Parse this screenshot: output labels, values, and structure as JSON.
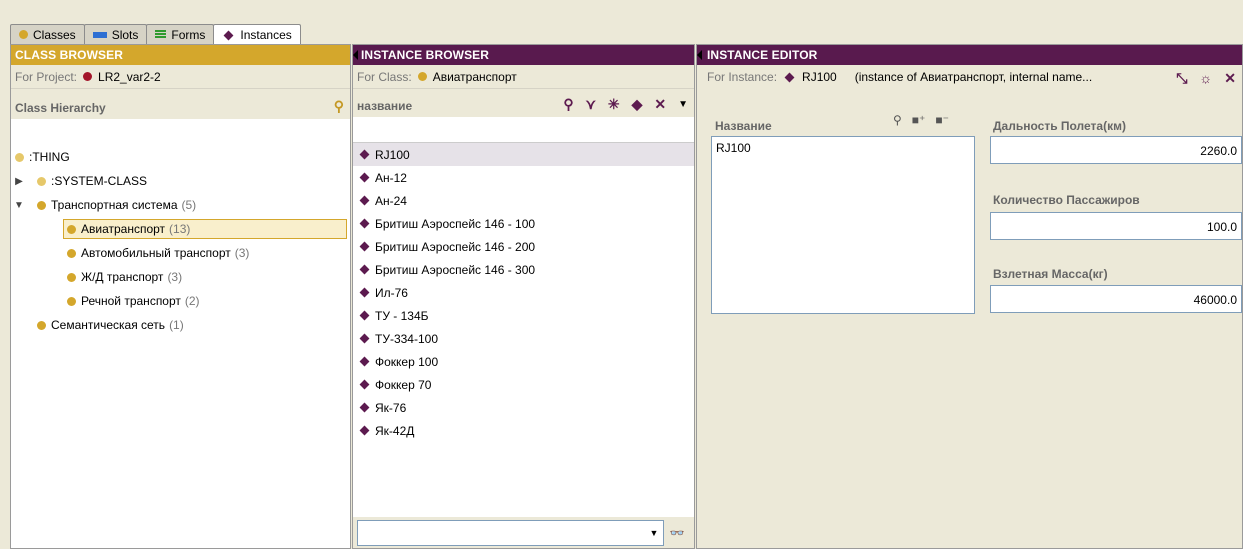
{
  "tabs": [
    {
      "label": "Classes",
      "icon": "class-dot-icon"
    },
    {
      "label": "Slots",
      "icon": "slot-icon"
    },
    {
      "label": "Forms",
      "icon": "form-icon"
    },
    {
      "label": "Instances",
      "icon": "instance-diamond-icon"
    }
  ],
  "class_browser": {
    "title": "CLASS BROWSER",
    "project_label": "For Project:",
    "project_name": "LR2_var2-2",
    "hierarchy_label": "Class Hierarchy",
    "tree": [
      {
        "label": ":THING",
        "count": ""
      },
      {
        "label": ":SYSTEM-CLASS",
        "count": ""
      },
      {
        "label": "Транспортная система",
        "count": "(5)"
      },
      {
        "label": "Авиатранспорт",
        "count": "(13)"
      },
      {
        "label": "Автомобильный транспорт",
        "count": "(3)"
      },
      {
        "label": "Ж/Д транспорт",
        "count": "(3)"
      },
      {
        "label": "Речной транспорт",
        "count": "(2)"
      },
      {
        "label": "Семантическая сеть",
        "count": "(1)"
      }
    ]
  },
  "instance_browser": {
    "title": "INSTANCE BROWSER",
    "class_label": "For Class:",
    "class_name": "Авиатранспорт",
    "column_label": "название",
    "instances": [
      "RJ100",
      "Ан-12",
      "Ан-24",
      "Бритиш Аэроспейс 146 - 100",
      "Бритиш Аэроспейс 146 - 200",
      "Бритиш Аэроспейс 146 - 300",
      "Ил-76",
      "ТУ - 134Б",
      "ТУ-334-100",
      "Фоккер 100",
      "Фоккер 70",
      "Як-76",
      "Як-42Д"
    ],
    "search_value": ""
  },
  "instance_editor": {
    "title": "INSTANCE EDITOR",
    "instance_label": "For Instance:",
    "instance_name": "RJ100",
    "instance_desc": "(instance of Авиатранспорт, internal name...",
    "name_label": "Название",
    "name_value": "RJ100",
    "fields": [
      {
        "label": "Дальность Полета(км)",
        "value": "2260.0"
      },
      {
        "label": "Количество Пассажиров",
        "value": "100.0"
      },
      {
        "label": "Взлетная Масса(кг)",
        "value": "46000.0"
      }
    ]
  },
  "colors": {
    "class_accent": "#d4a72c",
    "instance_accent": "#591a4e",
    "slot_accent": "#2d6fd3",
    "form_accent": "#2f9a2f"
  }
}
